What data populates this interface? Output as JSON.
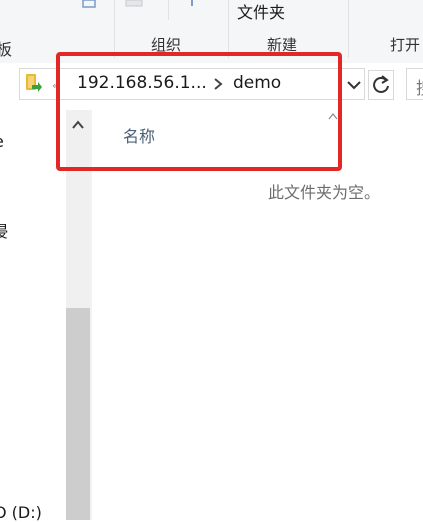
{
  "ribbon": {
    "new_folder_line1": "文件夹",
    "group_organize": "组织",
    "group_new": "新建",
    "group_open": "打开"
  },
  "address": {
    "crumb_1": "192.168.56.1...",
    "crumb_2": "demo",
    "search_hint": "搜"
  },
  "navigation": {
    "item_e": "e",
    "item_partial": "浸",
    "item_drive": "O (D:)"
  },
  "content": {
    "column_name": "名称",
    "empty_message": "此文件夹为空。"
  },
  "colors": {
    "highlight": "#e32626",
    "header_text": "#4b5f78",
    "folder_yellow": "#e8b83a",
    "folder_green": "#3aa13e"
  },
  "icons": {
    "folder": "folder-icon",
    "breadcrumb_separator": "chevron-right-icon",
    "dropdown": "chevron-down-icon",
    "refresh": "refresh-icon",
    "scroll_up": "chevron-up-icon",
    "sort": "sort-up-icon"
  }
}
